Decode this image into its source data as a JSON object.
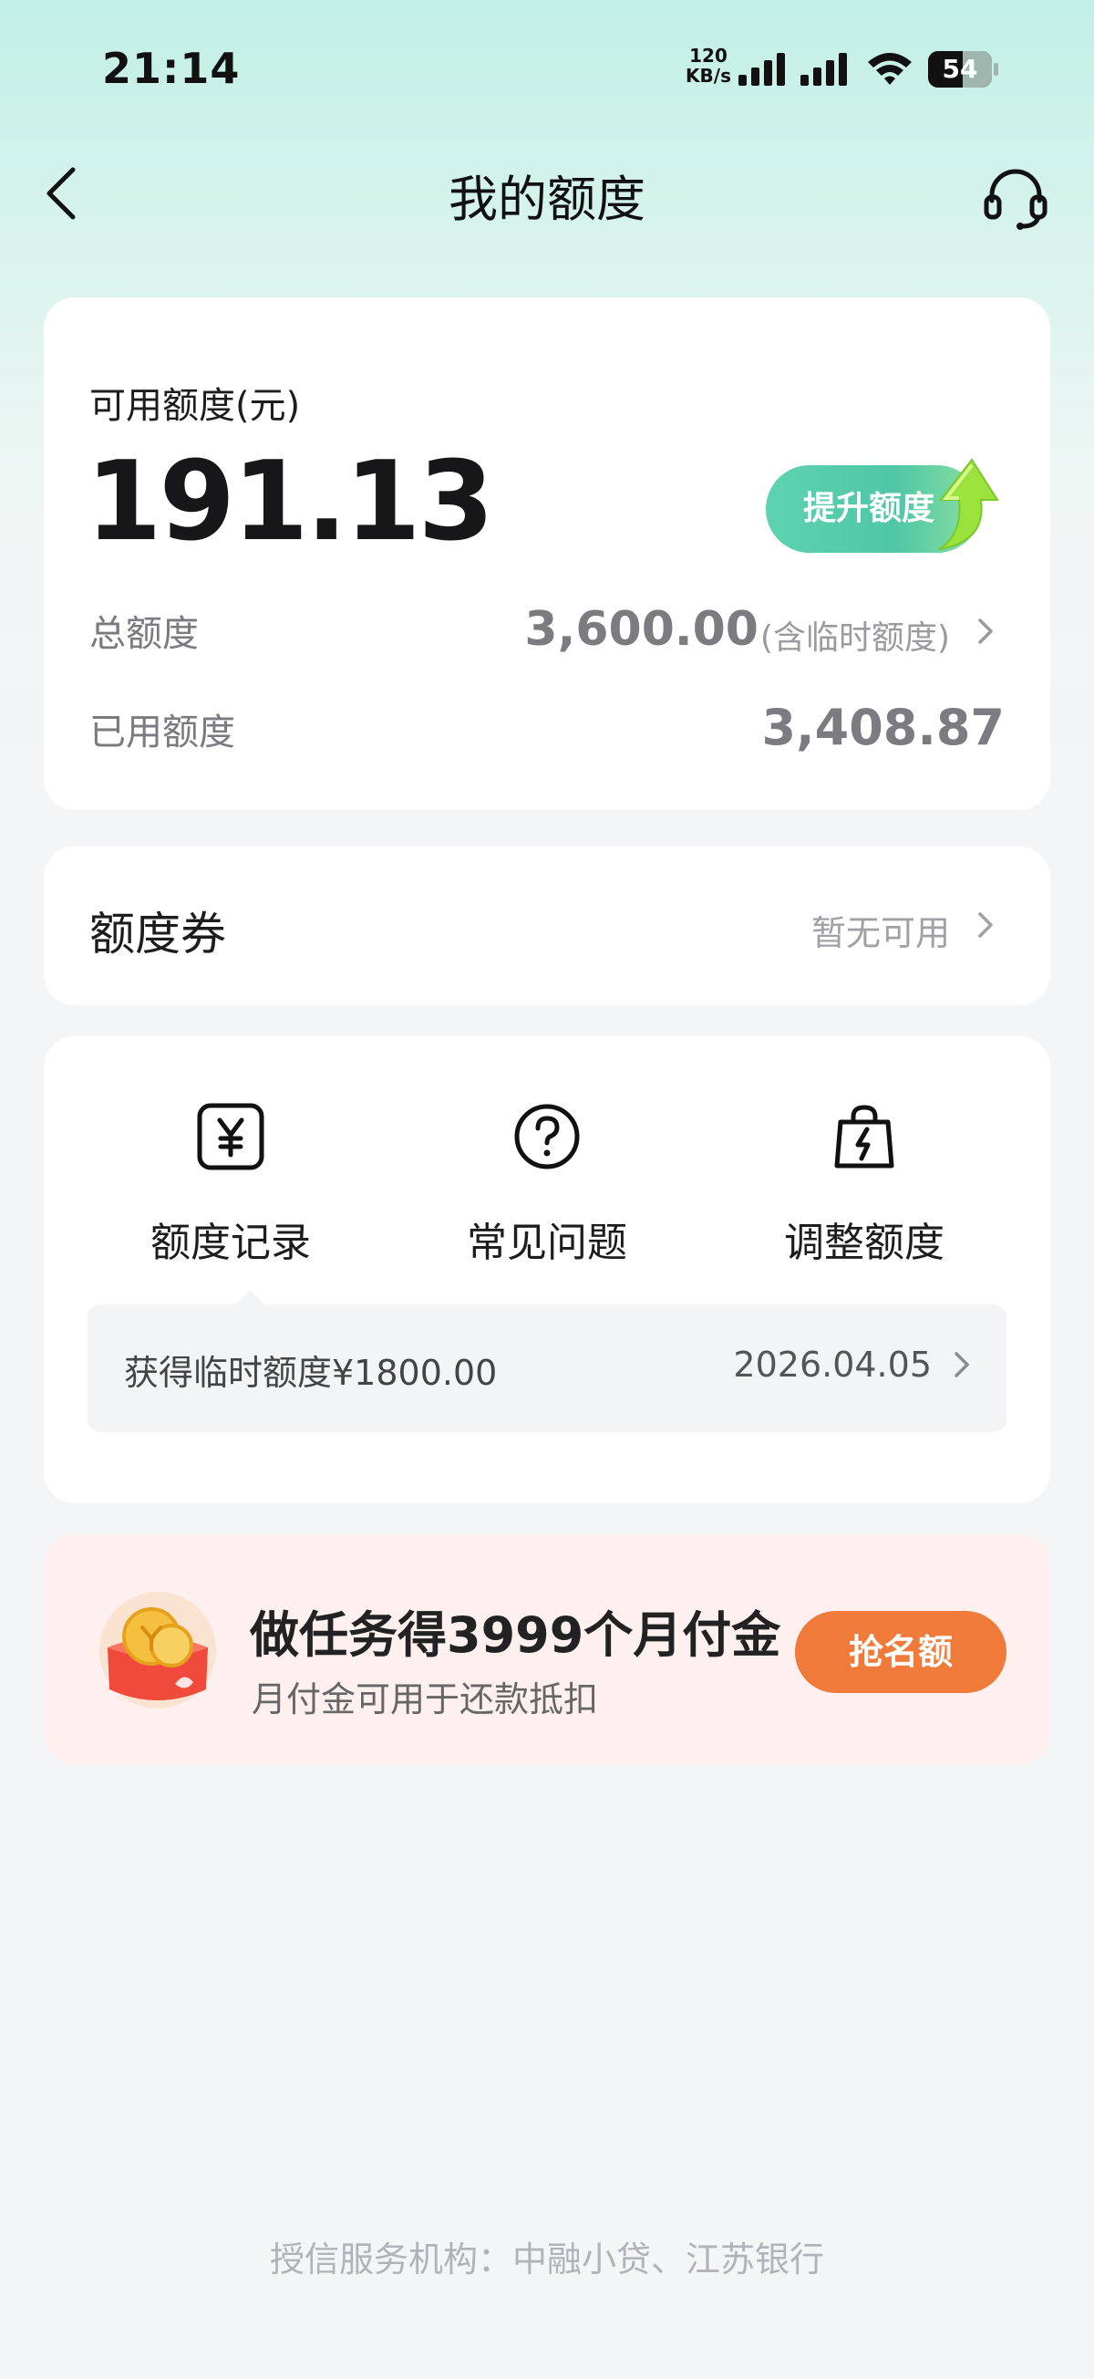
{
  "status_bar": {
    "time": "21:14",
    "net_speed_value": "120",
    "net_speed_unit": "KB/s",
    "battery_level": 54,
    "battery_text": "54"
  },
  "nav": {
    "title": "我的额度",
    "back_icon": "chevron-left-icon",
    "service_icon": "headset-icon"
  },
  "quota": {
    "available_label": "可用额度(元)",
    "available_amount": "191.13",
    "raise_button": "提升额度",
    "total_label": "总额度",
    "total_value": "3,600.00",
    "total_note": "(含临时额度)",
    "used_label": "已用额度",
    "used_value": "3,408.87"
  },
  "coupon": {
    "title": "额度券",
    "status": "暂无可用"
  },
  "actions": [
    {
      "label": "额度记录",
      "icon": "yuan-receipt-icon"
    },
    {
      "label": "常见问题",
      "icon": "question-circle-icon"
    },
    {
      "label": "调整额度",
      "icon": "lightning-bag-icon"
    }
  ],
  "record": {
    "text": "获得临时额度¥1800.00",
    "date": "2026.04.05"
  },
  "promo": {
    "title": "做任务得3999个月付金",
    "subtitle": "月付金可用于还款抵扣",
    "button": "抢名额",
    "image_icon": "red-envelope-coins-icon"
  },
  "footer": "授信服务机构：中融小贷、江苏银行",
  "colors": {
    "accent_green": "#4fc6a6",
    "promo_orange": "#f07a3a",
    "promo_bg": "#fdf0ef"
  }
}
